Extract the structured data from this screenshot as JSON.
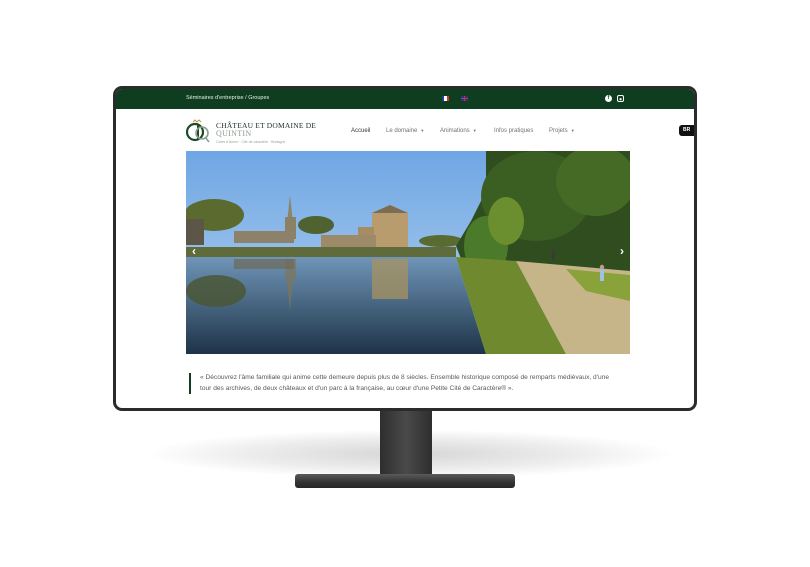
{
  "topbar": {
    "link_text": "Séminaires d'entreprise / Groupes",
    "languages": [
      {
        "code": "fr",
        "icon": "flag-france-icon"
      },
      {
        "code": "en",
        "icon": "flag-uk-icon"
      }
    ],
    "social": [
      {
        "name": "facebook",
        "icon": "facebook-icon"
      },
      {
        "name": "instagram",
        "icon": "instagram-icon"
      }
    ],
    "background_color": "#0f3d1f"
  },
  "logo": {
    "title": "CHÂTEAU ET DOMAINE DE",
    "subtitle": "QUINTIN",
    "tagline": "Côtes d'Armor · Cité de caractère · Bretagne",
    "monogram": "DQ"
  },
  "nav": {
    "items": [
      {
        "label": "Accueil",
        "active": true,
        "dropdown": false
      },
      {
        "label": "Le domaine",
        "active": false,
        "dropdown": true
      },
      {
        "label": "Animations",
        "active": false,
        "dropdown": true
      },
      {
        "label": "Infos pratiques",
        "active": false,
        "dropdown": false
      },
      {
        "label": "Projets",
        "active": false,
        "dropdown": true
      }
    ],
    "side_tab_label": "BR"
  },
  "slider": {
    "prev_icon": "chevron-left-icon",
    "next_icon": "chevron-right-icon",
    "prev_glyph": "‹",
    "next_glyph": "›"
  },
  "intro": {
    "text": "« Découvrez l'âme familiale qui anime cette demeure depuis plus de 8 siècles. Ensemble historique composé de remparts médiévaux, d'une tour des archives, de deux châteaux et d'un parc à la française, au cœur d'une Petite Cité de Caractère® »."
  },
  "colors": {
    "brand_green": "#0f3d1f",
    "text_gray": "#555b56"
  }
}
